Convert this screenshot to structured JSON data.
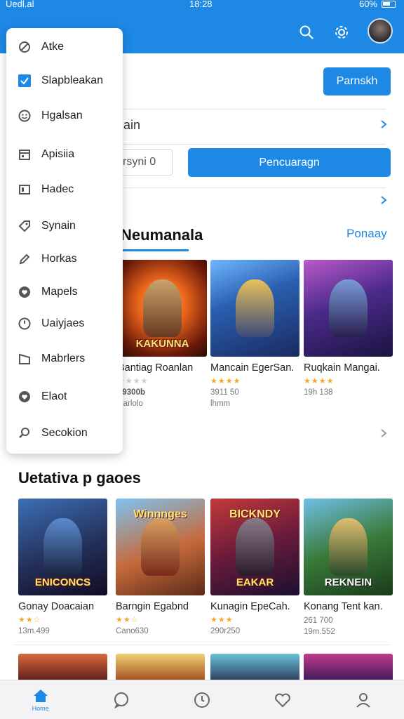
{
  "status_bar": {
    "carrier": "Uedl.al",
    "time": "18:28",
    "battery": "60%"
  },
  "header": {
    "icons": [
      "search-icon",
      "settings-icon",
      "avatar"
    ],
    "accent": "#1e88e5"
  },
  "drawer": {
    "items": [
      {
        "label": "Atke",
        "icon": "circle-slash-icon"
      },
      {
        "label": "Slapbleakan",
        "icon": "checkbox-icon",
        "active": true
      },
      {
        "label": "Hgalsan",
        "icon": "smiley-icon"
      },
      {
        "label": "Apisiia",
        "icon": "calendar-icon"
      },
      {
        "label": "Hadec",
        "icon": "square-icon"
      },
      {
        "label": "Synain",
        "icon": "tag-icon"
      },
      {
        "label": "Horkas",
        "icon": "pencil-icon"
      },
      {
        "label": "Mapels",
        "icon": "heart-icon"
      },
      {
        "label": "Uaiyjaes",
        "icon": "clock-icon"
      },
      {
        "label": "Mabrlers",
        "icon": "folder-icon"
      },
      {
        "label": "Elaot",
        "icon": "heart-icon"
      },
      {
        "label": "Secokion",
        "icon": "search-icon"
      }
    ]
  },
  "main": {
    "top_button": "Parnskh",
    "row1_text": "ain",
    "input_value": "rsyni 0",
    "action_button": "Pencuaragn",
    "section1": {
      "title": "Neumanala",
      "link": "Ponaay",
      "cards": [
        {
          "title": "Bantiag Roanlan",
          "stars": "★★★★",
          "meta": "Barlolo",
          "price": "39300b",
          "cap": "KAKUNNA"
        },
        {
          "title": "Mancain EgerSan.",
          "stars": "★★★★",
          "meta": "lhmm",
          "price": "3911 50",
          "cap": ""
        },
        {
          "title": "Ruqkain Mangai.",
          "stars": "★★★★",
          "meta": "",
          "price": "19h 138",
          "cap": ""
        }
      ]
    },
    "section2": {
      "title": "Uetativa p gaoes",
      "cards": [
        {
          "title": "Gonay Doacaian",
          "stars": "★★☆",
          "meta": "13m.499",
          "cap": "ENICONCS",
          "topcap": ""
        },
        {
          "title": "Barngin Egabnd",
          "stars": "★★☆",
          "meta": "Cano630",
          "cap": "",
          "topcap": "Winnnges"
        },
        {
          "title": "Kunagin EpeCah.",
          "stars": "★★★",
          "meta": "290r250",
          "cap": "EAKAR",
          "topcap": "BICKNDY"
        },
        {
          "title": "Konang Tent kan.",
          "stars": "",
          "meta": "19m.552",
          "price": "261 700",
          "cap": "",
          "topcap": "REKNEIN"
        }
      ]
    }
  },
  "bottom_nav": {
    "items": [
      "home-icon",
      "chat-icon",
      "clock-icon",
      "heart-icon",
      "profile-icon"
    ],
    "home_label": "Home"
  }
}
